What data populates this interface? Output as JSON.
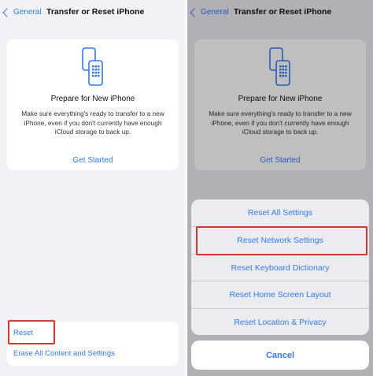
{
  "colors": {
    "accent": "#2f7bf6",
    "highlight": "#e0312b"
  },
  "left": {
    "nav": {
      "back_label": "General",
      "title": "Transfer or Reset iPhone"
    },
    "card": {
      "icon": "iphone-transfer-icon",
      "title": "Prepare for New iPhone",
      "description": "Make sure everything's ready to transfer to a new iPhone, even if you don't currently have enough iCloud storage to back up.",
      "button_label": "Get Started"
    },
    "list": {
      "reset_label": "Reset",
      "erase_label": "Erase All Content and Settings"
    }
  },
  "right": {
    "nav": {
      "back_label": "General",
      "title": "Transfer or Reset iPhone"
    },
    "card": {
      "title": "Prepare for New iPhone",
      "description": "Make sure everything's ready to transfer to a new iPhone, even if you don't currently have enough iCloud storage to back up.",
      "button_label": "Get Started"
    },
    "action_sheet": {
      "items": [
        "Reset All Settings",
        "Reset Network Settings",
        "Reset Keyboard Dictionary",
        "Reset Home Screen Layout",
        "Reset Location & Privacy"
      ],
      "cancel_label": "Cancel"
    }
  }
}
